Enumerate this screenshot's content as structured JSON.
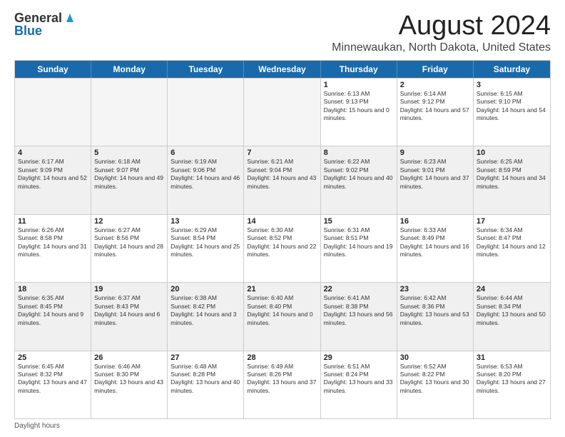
{
  "logo": {
    "general": "General",
    "blue": "Blue"
  },
  "title": "August 2024",
  "location": "Minnewaukan, North Dakota, United States",
  "days_of_week": [
    "Sunday",
    "Monday",
    "Tuesday",
    "Wednesday",
    "Thursday",
    "Friday",
    "Saturday"
  ],
  "weeks": [
    [
      {
        "day": "",
        "empty": true
      },
      {
        "day": "",
        "empty": true
      },
      {
        "day": "",
        "empty": true
      },
      {
        "day": "",
        "empty": true
      },
      {
        "day": "1",
        "sunrise": "6:13 AM",
        "sunset": "9:13 PM",
        "daylight": "15 hours and 0 minutes."
      },
      {
        "day": "2",
        "sunrise": "6:14 AM",
        "sunset": "9:12 PM",
        "daylight": "14 hours and 57 minutes."
      },
      {
        "day": "3",
        "sunrise": "6:15 AM",
        "sunset": "9:10 PM",
        "daylight": "14 hours and 54 minutes."
      }
    ],
    [
      {
        "day": "4",
        "sunrise": "6:17 AM",
        "sunset": "9:09 PM",
        "daylight": "14 hours and 52 minutes."
      },
      {
        "day": "5",
        "sunrise": "6:18 AM",
        "sunset": "9:07 PM",
        "daylight": "14 hours and 49 minutes."
      },
      {
        "day": "6",
        "sunrise": "6:19 AM",
        "sunset": "9:06 PM",
        "daylight": "14 hours and 46 minutes."
      },
      {
        "day": "7",
        "sunrise": "6:21 AM",
        "sunset": "9:04 PM",
        "daylight": "14 hours and 43 minutes."
      },
      {
        "day": "8",
        "sunrise": "6:22 AM",
        "sunset": "9:02 PM",
        "daylight": "14 hours and 40 minutes."
      },
      {
        "day": "9",
        "sunrise": "6:23 AM",
        "sunset": "9:01 PM",
        "daylight": "14 hours and 37 minutes."
      },
      {
        "day": "10",
        "sunrise": "6:25 AM",
        "sunset": "8:59 PM",
        "daylight": "14 hours and 34 minutes."
      }
    ],
    [
      {
        "day": "11",
        "sunrise": "6:26 AM",
        "sunset": "8:58 PM",
        "daylight": "14 hours and 31 minutes."
      },
      {
        "day": "12",
        "sunrise": "6:27 AM",
        "sunset": "8:56 PM",
        "daylight": "14 hours and 28 minutes."
      },
      {
        "day": "13",
        "sunrise": "6:29 AM",
        "sunset": "8:54 PM",
        "daylight": "14 hours and 25 minutes."
      },
      {
        "day": "14",
        "sunrise": "6:30 AM",
        "sunset": "8:52 PM",
        "daylight": "14 hours and 22 minutes."
      },
      {
        "day": "15",
        "sunrise": "6:31 AM",
        "sunset": "8:51 PM",
        "daylight": "14 hours and 19 minutes."
      },
      {
        "day": "16",
        "sunrise": "6:33 AM",
        "sunset": "8:49 PM",
        "daylight": "14 hours and 16 minutes."
      },
      {
        "day": "17",
        "sunrise": "6:34 AM",
        "sunset": "8:47 PM",
        "daylight": "14 hours and 12 minutes."
      }
    ],
    [
      {
        "day": "18",
        "sunrise": "6:35 AM",
        "sunset": "8:45 PM",
        "daylight": "14 hours and 9 minutes."
      },
      {
        "day": "19",
        "sunrise": "6:37 AM",
        "sunset": "8:43 PM",
        "daylight": "14 hours and 6 minutes."
      },
      {
        "day": "20",
        "sunrise": "6:38 AM",
        "sunset": "8:42 PM",
        "daylight": "14 hours and 3 minutes."
      },
      {
        "day": "21",
        "sunrise": "6:40 AM",
        "sunset": "8:40 PM",
        "daylight": "14 hours and 0 minutes."
      },
      {
        "day": "22",
        "sunrise": "6:41 AM",
        "sunset": "8:38 PM",
        "daylight": "13 hours and 56 minutes."
      },
      {
        "day": "23",
        "sunrise": "6:42 AM",
        "sunset": "8:36 PM",
        "daylight": "13 hours and 53 minutes."
      },
      {
        "day": "24",
        "sunrise": "6:44 AM",
        "sunset": "8:34 PM",
        "daylight": "13 hours and 50 minutes."
      }
    ],
    [
      {
        "day": "25",
        "sunrise": "6:45 AM",
        "sunset": "8:32 PM",
        "daylight": "13 hours and 47 minutes."
      },
      {
        "day": "26",
        "sunrise": "6:46 AM",
        "sunset": "8:30 PM",
        "daylight": "13 hours and 43 minutes."
      },
      {
        "day": "27",
        "sunrise": "6:48 AM",
        "sunset": "8:28 PM",
        "daylight": "13 hours and 40 minutes."
      },
      {
        "day": "28",
        "sunrise": "6:49 AM",
        "sunset": "8:26 PM",
        "daylight": "13 hours and 37 minutes."
      },
      {
        "day": "29",
        "sunrise": "6:51 AM",
        "sunset": "8:24 PM",
        "daylight": "13 hours and 33 minutes."
      },
      {
        "day": "30",
        "sunrise": "6:52 AM",
        "sunset": "8:22 PM",
        "daylight": "13 hours and 30 minutes."
      },
      {
        "day": "31",
        "sunrise": "6:53 AM",
        "sunset": "8:20 PM",
        "daylight": "13 hours and 27 minutes."
      }
    ]
  ],
  "footer": "Daylight hours"
}
